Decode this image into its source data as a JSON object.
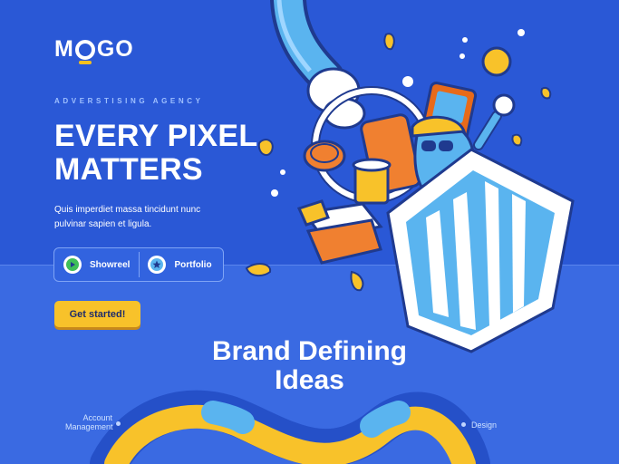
{
  "brand": {
    "logo": "MOGO"
  },
  "hero": {
    "tagline": "ADVERSTISING AGENCY",
    "headline_line1": "EVERY PIXEL",
    "headline_line2": "MATTERS",
    "description": "Quis imperdiet massa tincidunt nunc pulvinar sapien et ligula."
  },
  "actions": {
    "showreel_label": "Showreel",
    "portfolio_label": "Portfolio",
    "cta_label": "Get started!"
  },
  "section": {
    "title_line1": "Brand Defining",
    "title_line2": "Ideas",
    "label_account": "Account Management",
    "label_design": "Design"
  },
  "colors": {
    "background": "#2f5fdc",
    "accent_yellow": "#f8c22a",
    "accent_light_blue": "#5ab4ef",
    "text_primary": "#ffffff"
  },
  "icons": {
    "showreel": "play-icon",
    "portfolio": "star-icon"
  }
}
